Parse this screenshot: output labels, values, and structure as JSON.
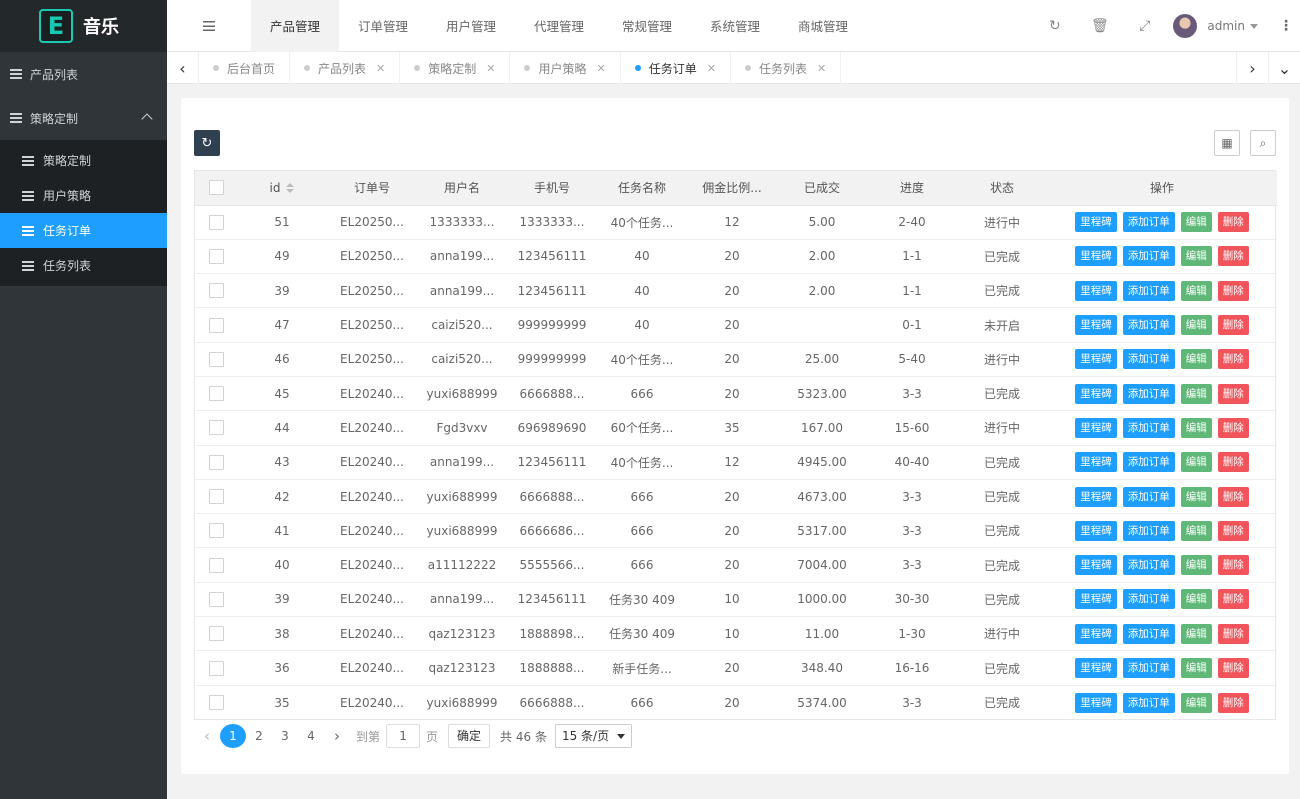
{
  "app": {
    "logo_letter": "E",
    "logo_text": "音乐"
  },
  "sidebar": {
    "items": [
      {
        "label": "产品列表"
      },
      {
        "label": "策略定制",
        "expanded": true
      }
    ],
    "sub_items": [
      {
        "label": "策略定制",
        "active": false
      },
      {
        "label": "用户策略",
        "active": false
      },
      {
        "label": "任务订单",
        "active": true
      },
      {
        "label": "任务列表",
        "active": false
      }
    ]
  },
  "header": {
    "menu": [
      {
        "label": "产品管理",
        "active": true
      },
      {
        "label": "订单管理"
      },
      {
        "label": "用户管理"
      },
      {
        "label": "代理管理"
      },
      {
        "label": "常规管理"
      },
      {
        "label": "系统管理"
      },
      {
        "label": "商城管理"
      }
    ],
    "icons": {
      "refresh": "refresh-icon",
      "trash": "trash-icon",
      "fullscreen": "fullscreen-icon"
    },
    "user": "admin"
  },
  "tabs": [
    {
      "label": "后台首页",
      "closable": false
    },
    {
      "label": "产品列表",
      "closable": true
    },
    {
      "label": "策略定制",
      "closable": true
    },
    {
      "label": "用户策略",
      "closable": true
    },
    {
      "label": "任务订单",
      "closable": true,
      "active": true
    },
    {
      "label": "任务列表",
      "closable": true
    }
  ],
  "table": {
    "columns": [
      "id",
      "订单号",
      "用户名",
      "手机号",
      "任务名称",
      "佣金比例...",
      "已成交",
      "进度",
      "状态",
      "操作"
    ],
    "actions": [
      "里程碑",
      "添加订单",
      "编辑",
      "删除"
    ],
    "rows": [
      [
        "51",
        "EL20250...",
        "1333333...",
        "1333333...",
        "40个任务...",
        "12",
        "5.00",
        "2-40",
        "进行中"
      ],
      [
        "49",
        "EL20250...",
        "anna199...",
        "123456111",
        "40",
        "20",
        "2.00",
        "1-1",
        "已完成"
      ],
      [
        "39",
        "EL20250...",
        "anna199...",
        "123456111",
        "40",
        "20",
        "2.00",
        "1-1",
        "已完成"
      ],
      [
        "47",
        "EL20250...",
        "caizi520...",
        "999999999",
        "40",
        "20",
        "",
        "0-1",
        "未开启"
      ],
      [
        "46",
        "EL20250...",
        "caizi520...",
        "999999999",
        "40个任务...",
        "20",
        "25.00",
        "5-40",
        "进行中"
      ],
      [
        "45",
        "EL20240...",
        "yuxi688999",
        "6666888...",
        "666",
        "20",
        "5323.00",
        "3-3",
        "已完成"
      ],
      [
        "44",
        "EL20240...",
        "Fgd3vxv",
        "696989690",
        "60个任务...",
        "35",
        "167.00",
        "15-60",
        "进行中"
      ],
      [
        "43",
        "EL20240...",
        "anna199...",
        "123456111",
        "40个任务...",
        "12",
        "4945.00",
        "40-40",
        "已完成"
      ],
      [
        "42",
        "EL20240...",
        "yuxi688999",
        "6666888...",
        "666",
        "20",
        "4673.00",
        "3-3",
        "已完成"
      ],
      [
        "41",
        "EL20240...",
        "yuxi688999",
        "6666686...",
        "666",
        "20",
        "5317.00",
        "3-3",
        "已完成"
      ],
      [
        "40",
        "EL20240...",
        "a11112222",
        "5555566...",
        "666",
        "20",
        "7004.00",
        "3-3",
        "已完成"
      ],
      [
        "39",
        "EL20240...",
        "anna199...",
        "123456111",
        "任务30 409",
        "10",
        "1000.00",
        "30-30",
        "已完成"
      ],
      [
        "38",
        "EL20240...",
        "qaz123123",
        "1888898...",
        "任务30 409",
        "10",
        "11.00",
        "1-30",
        "进行中"
      ],
      [
        "36",
        "EL20240...",
        "qaz123123",
        "1888888...",
        "新手任务...",
        "20",
        "348.40",
        "16-16",
        "已完成"
      ],
      [
        "35",
        "EL20240...",
        "yuxi688999",
        "6666888...",
        "666",
        "20",
        "5374.00",
        "3-3",
        "已完成"
      ]
    ]
  },
  "pager": {
    "pages": [
      "1",
      "2",
      "3",
      "4"
    ],
    "current": "1",
    "goto_label": "到第",
    "goto_value": "1",
    "page_label": "页",
    "confirm": "确定",
    "total": "共 46 条",
    "page_size": "15 条/页"
  }
}
